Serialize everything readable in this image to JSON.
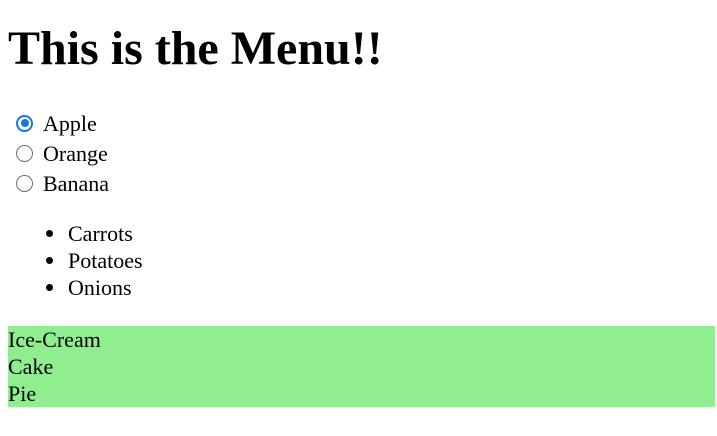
{
  "heading": {
    "title": "This is the Menu!!"
  },
  "fruits": {
    "options": [
      {
        "label": "Apple",
        "checked": true
      },
      {
        "label": "Orange",
        "checked": false
      },
      {
        "label": "Banana",
        "checked": false
      }
    ]
  },
  "vegetables": {
    "items": [
      "Carrots",
      "Potatoes",
      "Onions"
    ]
  },
  "desserts": {
    "background": "#90ee90",
    "items": [
      "Ice-Cream",
      "Cake",
      "Pie"
    ]
  },
  "colors": {
    "radio_accent": "#1a73e8"
  }
}
